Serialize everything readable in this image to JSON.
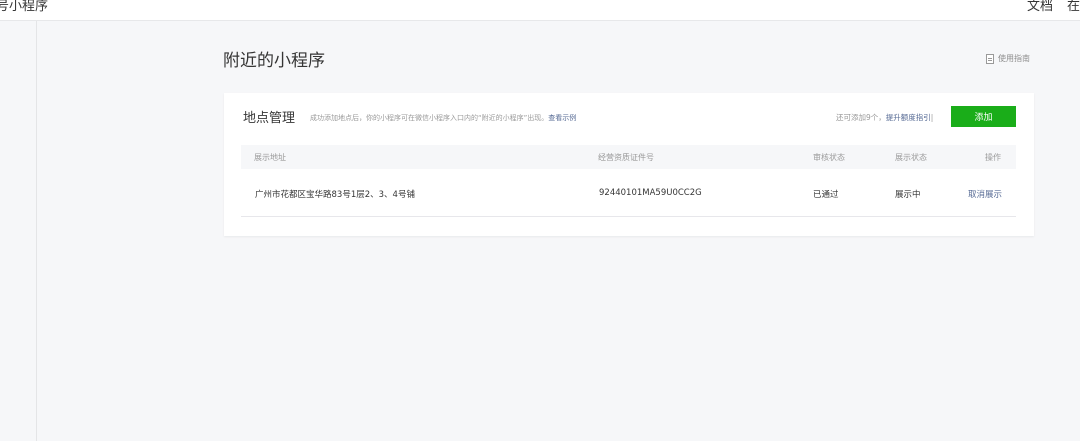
{
  "topbar": {
    "brand": "号小程序",
    "doc": "文档",
    "cut": "在"
  },
  "page": {
    "title": "附近的小程序",
    "guide_label": "使用指南"
  },
  "location_section": {
    "title": "地点管理",
    "description": "成功添加地点后，你的小程序可在微信小程序入口内的“附近的小程序”出现。",
    "example_link": "查看示例",
    "quota_text": "还可添加9个，",
    "quota_link": "提升额度指引",
    "quota_sep": "|",
    "add_button": "添加"
  },
  "table": {
    "headers": {
      "address": "展示地址",
      "license": "经营资质证件号",
      "review": "审核状态",
      "display": "展示状态",
      "action": "操作"
    },
    "rows": [
      {
        "address": "广州市花都区宝华路83号1层2、3、4号铺",
        "license": "92440101MA59U0CC2G",
        "review": "已通过",
        "display": "展示中",
        "action": "取消展示"
      }
    ]
  },
  "colors": {
    "primary_button": "#1aad19",
    "link": "#576b95"
  }
}
